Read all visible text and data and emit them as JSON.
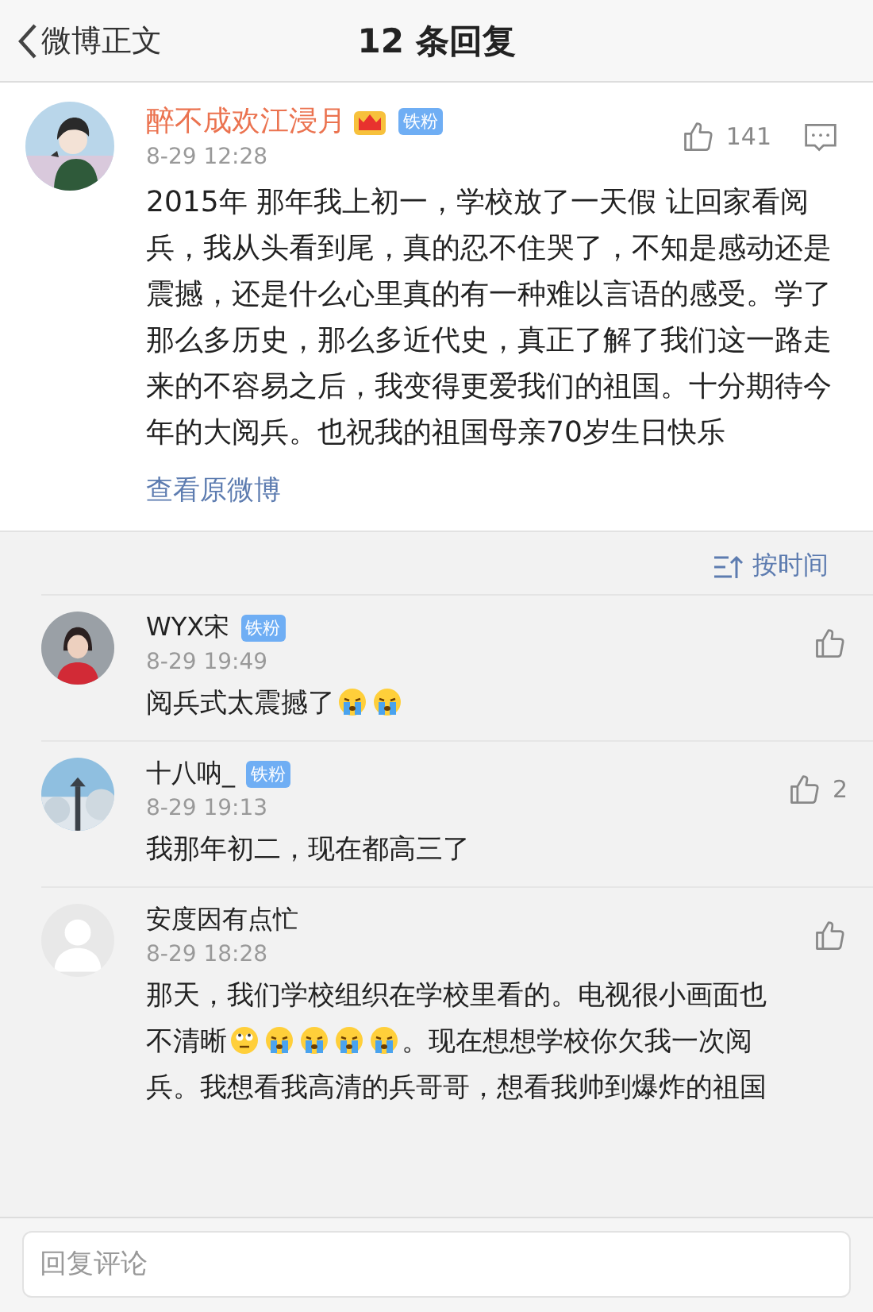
{
  "nav": {
    "back_label": "微博正文",
    "title": "12 条回复"
  },
  "post": {
    "author": "醉不成欢江浸月",
    "crowned": true,
    "badge": "铁粉",
    "time": "8-29 12:28",
    "likes": "141",
    "body": "2015年 那年我上初一，学校放了一天假 让回家看阅兵，我从头看到尾，真的忍不住哭了，不知是感动还是震撼，还是什么心里真的有一种难以言语的感受。学了那么多历史，那么多近代史，真正了解了我们这一路走来的不容易之后，我变得更爱我们的祖国。十分期待今年的大阅兵。也祝我的祖国母亲70岁生日快乐",
    "link": "查看原微博"
  },
  "sort": {
    "label": "按时间"
  },
  "comments": [
    {
      "author": "WYX宋",
      "badge": "铁粉",
      "time": "8-29 19:49",
      "lines": [
        [
          {
            "kind": "text",
            "text": "阅兵式太震撼了"
          },
          {
            "kind": "crying"
          },
          {
            "kind": "crying"
          }
        ]
      ]
    },
    {
      "author": "十八呐_",
      "badge": "铁粉",
      "time": "8-29 19:13",
      "likes": "2",
      "lines": [
        [
          {
            "kind": "text",
            "text": "我那年初二，现在都高三了"
          }
        ]
      ]
    },
    {
      "author": "安度因有点忙",
      "time": "8-29 18:28",
      "avatar": {
        "kind": "default"
      },
      "lines": [
        [
          {
            "kind": "text",
            "text": "那天，我们学校组织在学校里看的。电视很小画面也"
          }
        ],
        [
          {
            "kind": "text",
            "text": "不清晰"
          },
          {
            "kind": "rolling"
          },
          {
            "kind": "crying"
          },
          {
            "kind": "crying"
          },
          {
            "kind": "crying"
          },
          {
            "kind": "crying"
          },
          {
            "kind": "text",
            "text": "。现在想想学校你欠我一次阅"
          }
        ],
        [
          {
            "kind": "text",
            "text": "兵。我想看我高清的兵哥哥，想看我帅到爆炸的祖国"
          }
        ]
      ]
    }
  ],
  "reply": {
    "placeholder": "回复评论"
  }
}
